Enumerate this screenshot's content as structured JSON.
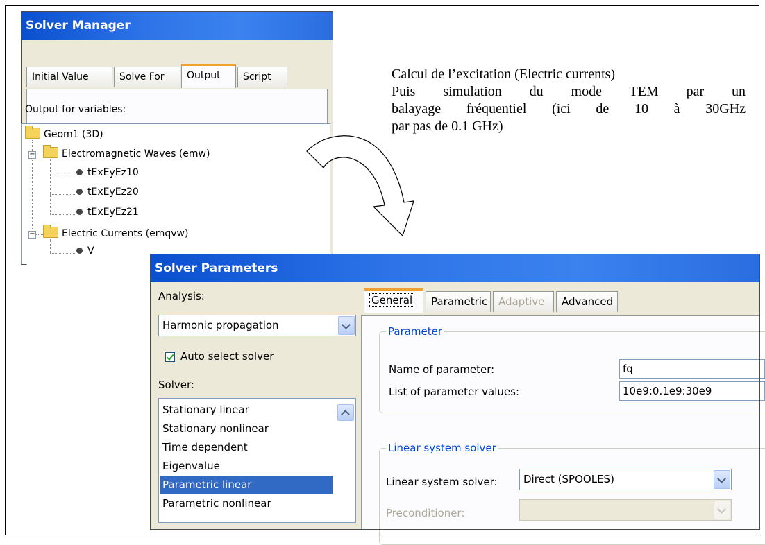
{
  "solver_manager": {
    "title": "Solver Manager",
    "tabs": [
      "Initial Value",
      "Solve For",
      "Output",
      "Script"
    ],
    "active_tab": "Output",
    "output_label": "Output for variables:",
    "tree": {
      "root": "Geom1 (3D)",
      "groups": [
        {
          "label": "Electromagnetic Waves (emw)",
          "items": [
            "tExEyEz10",
            "tExEyEz20",
            "tExEyEz21"
          ]
        },
        {
          "label": "Electric Currents (emqvw)",
          "items": [
            "V"
          ]
        }
      ]
    }
  },
  "annotation": {
    "line1": "Calcul de l’excitation (Electric currents)",
    "line2": "Puis simulation du mode TEM par un",
    "line3": "balayage fréquentiel (ici de 10 à 30GHz",
    "line4": "par pas de 0.1 GHz)"
  },
  "solver_parameters": {
    "title": "Solver Parameters",
    "analysis_label": "Analysis:",
    "analysis_value": "Harmonic propagation",
    "auto_select_label": "Auto select solver",
    "auto_select_checked": true,
    "solver_label": "Solver:",
    "solvers": [
      "Stationary linear",
      "Stationary nonlinear",
      "Time dependent",
      "Eigenvalue",
      "Parametric linear",
      "Parametric nonlinear"
    ],
    "selected_solver": "Parametric linear",
    "tabs": [
      "General",
      "Parametric",
      "Adaptive",
      "Advanced"
    ],
    "active_tab": "General",
    "disabled_tab": "Adaptive",
    "parameter_group": "Parameter",
    "name_label": "Name of parameter:",
    "name_value": "fq",
    "values_label": "List of parameter values:",
    "values_value": "10e9:0.1e9:30e9",
    "linear_group": "Linear system solver",
    "linear_label": "Linear system solver:",
    "linear_value": "Direct (SPOOLES)",
    "precond_label": "Preconditioner:",
    "precond_value": ""
  },
  "colors": {
    "titlebar": "#0a4fcf",
    "window_bg": "#ece9d8",
    "selection": "#316ac5",
    "group_title": "#0046d5",
    "arrow": "#000000"
  }
}
